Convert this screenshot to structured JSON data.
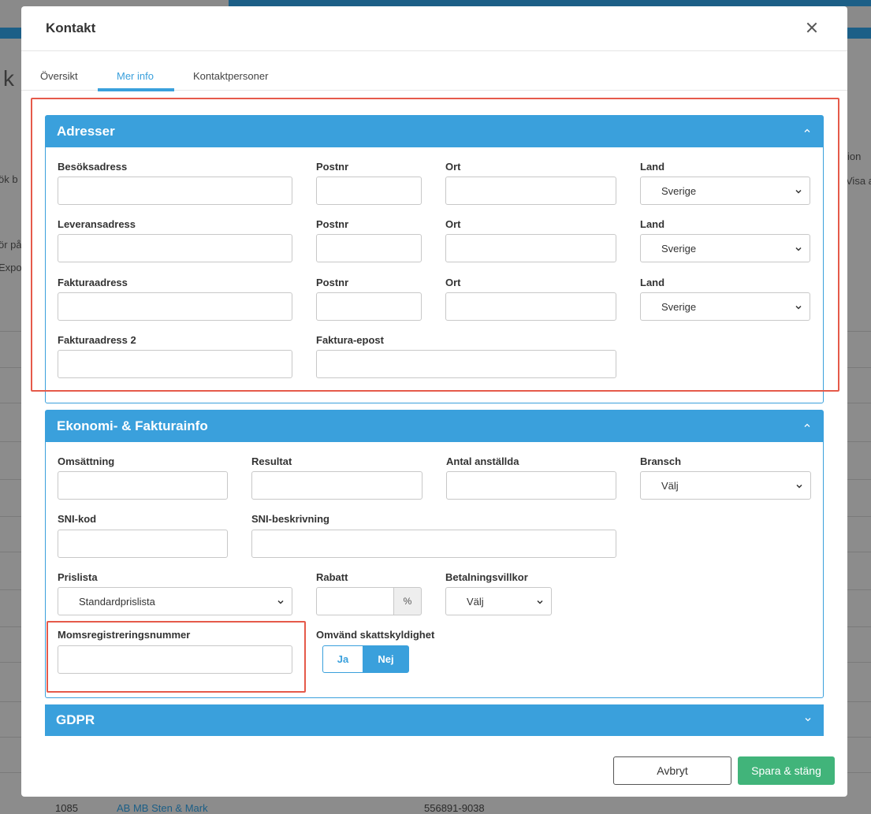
{
  "background": {
    "big_text": "k",
    "side_texts": [
      "ök b",
      "ör på",
      "Expo",
      "ion",
      "Visa a"
    ],
    "row_number": "1085",
    "row_company": "AB MB Sten & Mark",
    "row_orgnr": "556891-9038"
  },
  "modal": {
    "title": "Kontakt",
    "tabs": [
      "Översikt",
      "Mer info",
      "Kontaktpersoner"
    ],
    "active_tab": "Mer info"
  },
  "addresses": {
    "title": "Adresser",
    "rows": [
      {
        "address_label": "Besöksadress",
        "postnr_label": "Postnr",
        "ort_label": "Ort",
        "land_label": "Land",
        "land_value": "Sverige"
      },
      {
        "address_label": "Leveransadress",
        "postnr_label": "Postnr",
        "ort_label": "Ort",
        "land_label": "Land",
        "land_value": "Sverige"
      },
      {
        "address_label": "Fakturaadress",
        "postnr_label": "Postnr",
        "ort_label": "Ort",
        "land_label": "Land",
        "land_value": "Sverige"
      }
    ],
    "faktura2_label": "Fakturaadress 2",
    "faktura_epost_label": "Faktura-epost"
  },
  "economy": {
    "title": "Ekonomi- & Fakturainfo",
    "omsattning_label": "Omsättning",
    "resultat_label": "Resultat",
    "anstallda_label": "Antal anställda",
    "bransch_label": "Bransch",
    "bransch_value": "Välj",
    "sni_kod_label": "SNI-kod",
    "sni_beskrivning_label": "SNI-beskrivning",
    "prislista_label": "Prislista",
    "prislista_value": "Standardprislista",
    "rabatt_label": "Rabatt",
    "rabatt_unit": "%",
    "betalningsvillkor_label": "Betalningsvillkor",
    "betalningsvillkor_value": "Välj",
    "moms_label": "Momsregistreringsnummer",
    "omvand_label": "Omvänd skattskyldighet",
    "ja_label": "Ja",
    "nej_label": "Nej",
    "omvand_selected": "Nej"
  },
  "gdpr": {
    "title": "GDPR"
  },
  "footer": {
    "cancel_label": "Avbryt",
    "save_label": "Spara & stäng"
  },
  "colors": {
    "accent": "#3aa0dc",
    "save": "#41b47a",
    "highlight": "#e55a4a"
  }
}
